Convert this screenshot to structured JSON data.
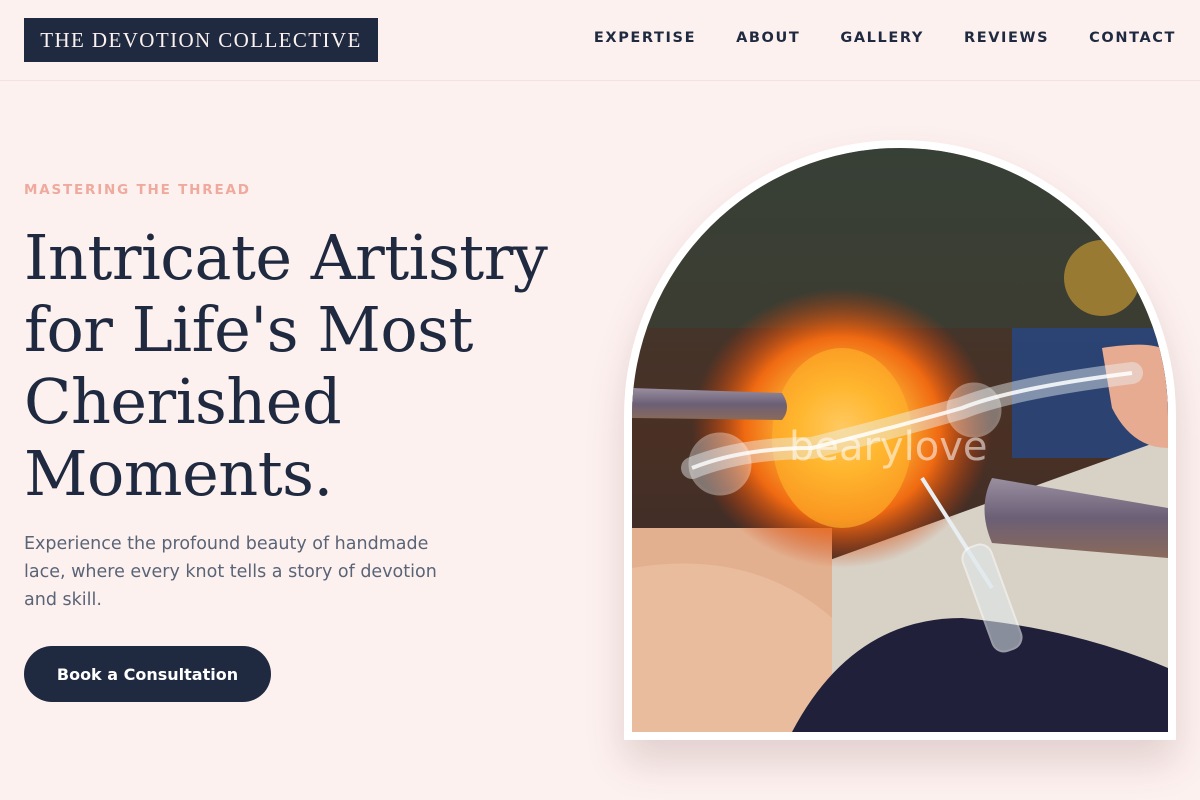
{
  "header": {
    "logo": "THE DEVOTION COLLECTIVE",
    "nav": [
      "EXPERTISE",
      "ABOUT",
      "GALLERY",
      "REVIEWS",
      "CONTACT"
    ]
  },
  "hero": {
    "eyebrow": "MASTERING THE THREAD",
    "headline": "Intricate Artistry for Life's Most Cherished Moments.",
    "lead": "Experience the profound beauty of handmade lace, where every knot tells a story of devotion and skill.",
    "cta": "Book a Consultation"
  },
  "image": {
    "watermark": "bearylove"
  },
  "colors": {
    "background": "#fdf1ef",
    "navy": "#1f2a40",
    "accent": "#efa99d",
    "body_text": "#5a6477"
  }
}
